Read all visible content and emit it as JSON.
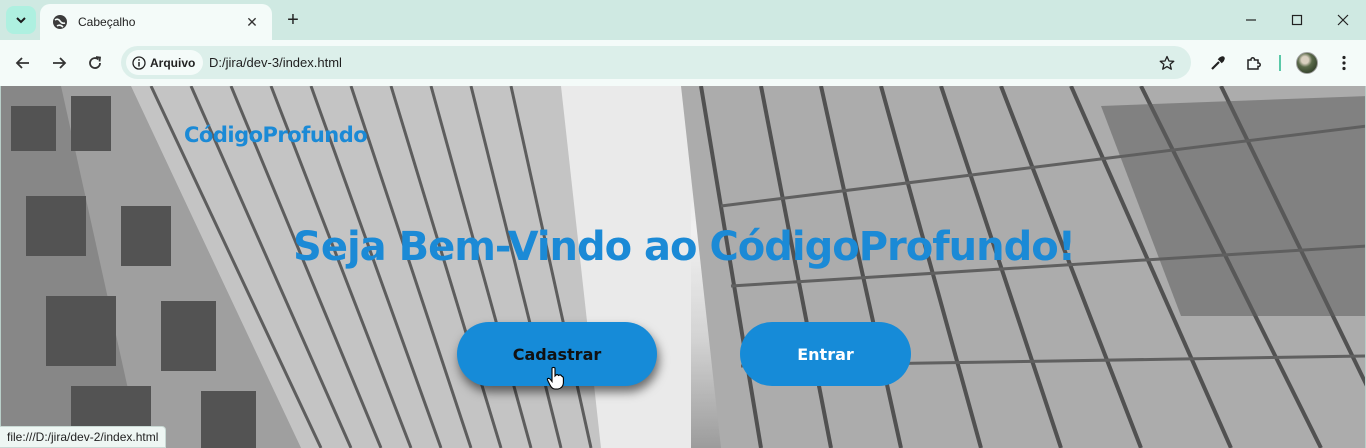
{
  "browser": {
    "tab": {
      "title": "Cabeçalho",
      "favicon": "globe-icon"
    },
    "address_bar": {
      "chip_label": "Arquivo",
      "url": "D:/jira/dev-3/index.html"
    },
    "status_url": "file:///D:/jira/dev-2/index.html"
  },
  "page": {
    "brand": "CódigoProfundo",
    "title": "Seja Bem-Vindo ao CódigoProfundo!",
    "buttons": {
      "signup": "Cadastrar",
      "login": "Entrar"
    }
  },
  "colors": {
    "accent": "#1b8ad6",
    "button_bg": "#168bd8",
    "chrome_bg": "#cfe9e2"
  }
}
